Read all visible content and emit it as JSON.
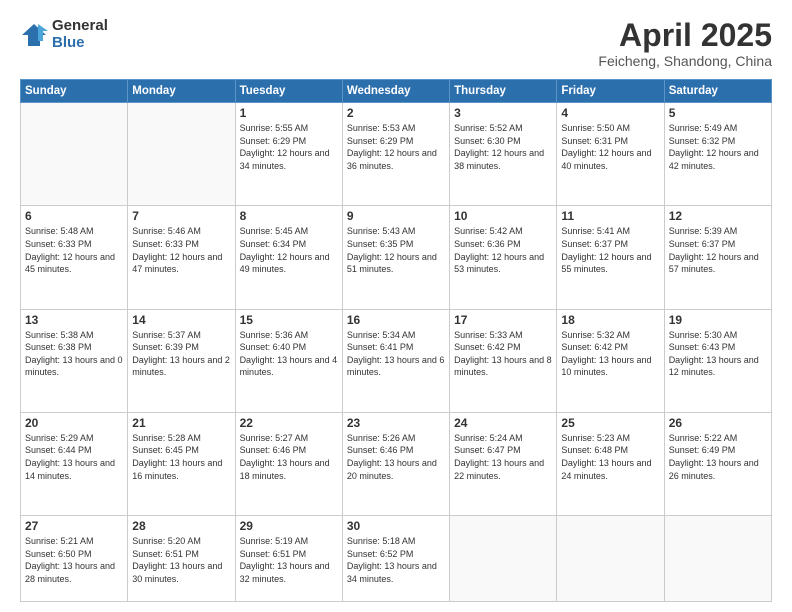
{
  "logo": {
    "general": "General",
    "blue": "Blue"
  },
  "header": {
    "month": "April 2025",
    "location": "Feicheng, Shandong, China"
  },
  "days_of_week": [
    "Sunday",
    "Monday",
    "Tuesday",
    "Wednesday",
    "Thursday",
    "Friday",
    "Saturday"
  ],
  "weeks": [
    [
      {
        "day": "",
        "info": ""
      },
      {
        "day": "",
        "info": ""
      },
      {
        "day": "1",
        "info": "Sunrise: 5:55 AM\nSunset: 6:29 PM\nDaylight: 12 hours\nand 34 minutes."
      },
      {
        "day": "2",
        "info": "Sunrise: 5:53 AM\nSunset: 6:29 PM\nDaylight: 12 hours\nand 36 minutes."
      },
      {
        "day": "3",
        "info": "Sunrise: 5:52 AM\nSunset: 6:30 PM\nDaylight: 12 hours\nand 38 minutes."
      },
      {
        "day": "4",
        "info": "Sunrise: 5:50 AM\nSunset: 6:31 PM\nDaylight: 12 hours\nand 40 minutes."
      },
      {
        "day": "5",
        "info": "Sunrise: 5:49 AM\nSunset: 6:32 PM\nDaylight: 12 hours\nand 42 minutes."
      }
    ],
    [
      {
        "day": "6",
        "info": "Sunrise: 5:48 AM\nSunset: 6:33 PM\nDaylight: 12 hours\nand 45 minutes."
      },
      {
        "day": "7",
        "info": "Sunrise: 5:46 AM\nSunset: 6:33 PM\nDaylight: 12 hours\nand 47 minutes."
      },
      {
        "day": "8",
        "info": "Sunrise: 5:45 AM\nSunset: 6:34 PM\nDaylight: 12 hours\nand 49 minutes."
      },
      {
        "day": "9",
        "info": "Sunrise: 5:43 AM\nSunset: 6:35 PM\nDaylight: 12 hours\nand 51 minutes."
      },
      {
        "day": "10",
        "info": "Sunrise: 5:42 AM\nSunset: 6:36 PM\nDaylight: 12 hours\nand 53 minutes."
      },
      {
        "day": "11",
        "info": "Sunrise: 5:41 AM\nSunset: 6:37 PM\nDaylight: 12 hours\nand 55 minutes."
      },
      {
        "day": "12",
        "info": "Sunrise: 5:39 AM\nSunset: 6:37 PM\nDaylight: 12 hours\nand 57 minutes."
      }
    ],
    [
      {
        "day": "13",
        "info": "Sunrise: 5:38 AM\nSunset: 6:38 PM\nDaylight: 13 hours\nand 0 minutes."
      },
      {
        "day": "14",
        "info": "Sunrise: 5:37 AM\nSunset: 6:39 PM\nDaylight: 13 hours\nand 2 minutes."
      },
      {
        "day": "15",
        "info": "Sunrise: 5:36 AM\nSunset: 6:40 PM\nDaylight: 13 hours\nand 4 minutes."
      },
      {
        "day": "16",
        "info": "Sunrise: 5:34 AM\nSunset: 6:41 PM\nDaylight: 13 hours\nand 6 minutes."
      },
      {
        "day": "17",
        "info": "Sunrise: 5:33 AM\nSunset: 6:42 PM\nDaylight: 13 hours\nand 8 minutes."
      },
      {
        "day": "18",
        "info": "Sunrise: 5:32 AM\nSunset: 6:42 PM\nDaylight: 13 hours\nand 10 minutes."
      },
      {
        "day": "19",
        "info": "Sunrise: 5:30 AM\nSunset: 6:43 PM\nDaylight: 13 hours\nand 12 minutes."
      }
    ],
    [
      {
        "day": "20",
        "info": "Sunrise: 5:29 AM\nSunset: 6:44 PM\nDaylight: 13 hours\nand 14 minutes."
      },
      {
        "day": "21",
        "info": "Sunrise: 5:28 AM\nSunset: 6:45 PM\nDaylight: 13 hours\nand 16 minutes."
      },
      {
        "day": "22",
        "info": "Sunrise: 5:27 AM\nSunset: 6:46 PM\nDaylight: 13 hours\nand 18 minutes."
      },
      {
        "day": "23",
        "info": "Sunrise: 5:26 AM\nSunset: 6:46 PM\nDaylight: 13 hours\nand 20 minutes."
      },
      {
        "day": "24",
        "info": "Sunrise: 5:24 AM\nSunset: 6:47 PM\nDaylight: 13 hours\nand 22 minutes."
      },
      {
        "day": "25",
        "info": "Sunrise: 5:23 AM\nSunset: 6:48 PM\nDaylight: 13 hours\nand 24 minutes."
      },
      {
        "day": "26",
        "info": "Sunrise: 5:22 AM\nSunset: 6:49 PM\nDaylight: 13 hours\nand 26 minutes."
      }
    ],
    [
      {
        "day": "27",
        "info": "Sunrise: 5:21 AM\nSunset: 6:50 PM\nDaylight: 13 hours\nand 28 minutes."
      },
      {
        "day": "28",
        "info": "Sunrise: 5:20 AM\nSunset: 6:51 PM\nDaylight: 13 hours\nand 30 minutes."
      },
      {
        "day": "29",
        "info": "Sunrise: 5:19 AM\nSunset: 6:51 PM\nDaylight: 13 hours\nand 32 minutes."
      },
      {
        "day": "30",
        "info": "Sunrise: 5:18 AM\nSunset: 6:52 PM\nDaylight: 13 hours\nand 34 minutes."
      },
      {
        "day": "",
        "info": ""
      },
      {
        "day": "",
        "info": ""
      },
      {
        "day": "",
        "info": ""
      }
    ]
  ]
}
